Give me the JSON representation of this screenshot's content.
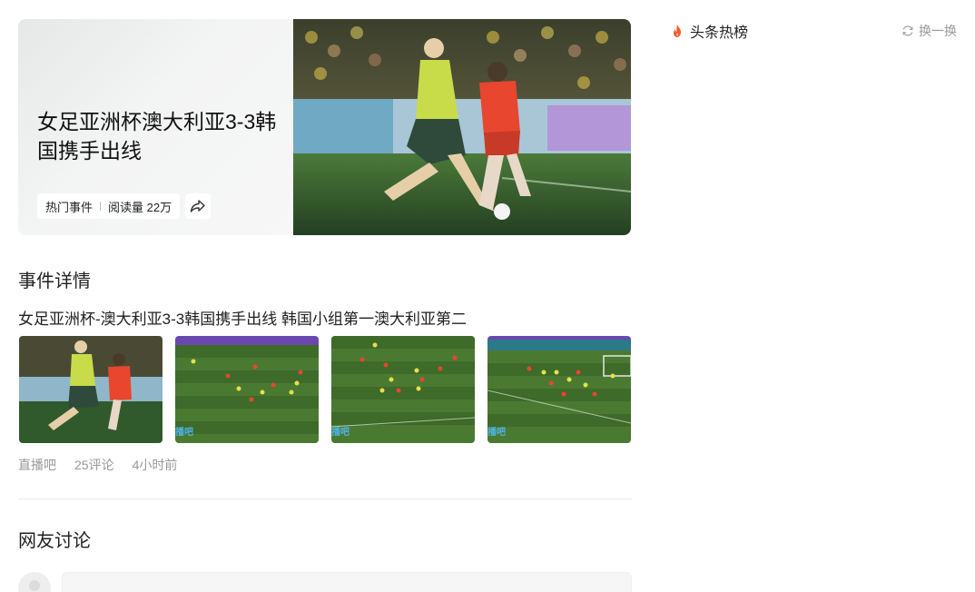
{
  "hero": {
    "title": "女足亚洲杯澳大利亚3-3韩国携手出线",
    "tag": "热门事件",
    "reads": "阅读量 22万"
  },
  "event": {
    "section_title": "事件详情",
    "headline": "女足亚洲杯-澳大利亚3-3韩国携手出线 韩国小组第一澳大利亚第二",
    "source": "直播吧",
    "comments": "25评论",
    "time": "4小时前",
    "watermark": "播吧"
  },
  "discussion": {
    "section_title": "网友讨论"
  },
  "sidebar": {
    "hot_title": "头条热榜",
    "refresh_label": "换一换"
  },
  "colors": {
    "pitch": "#3d6b2a",
    "australia_kit": "#c8dc4a",
    "korea_kit": "#e8462e",
    "fire": "#f5592a"
  }
}
